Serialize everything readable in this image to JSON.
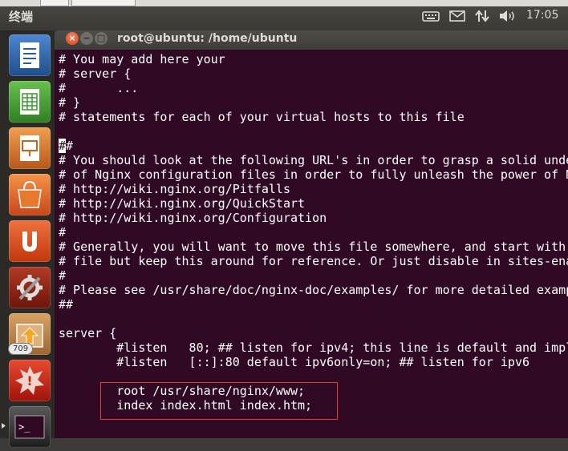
{
  "panel": {
    "app_title": "终端",
    "clock": "17:05",
    "indicators": [
      "keyboard-icon",
      "mail-icon",
      "network-arrows-icon",
      "volume-icon"
    ]
  },
  "launcher": {
    "items": [
      {
        "name": "writer-icon",
        "color": "#2a5b9e"
      },
      {
        "name": "calc-icon",
        "color": "#3a9a2e"
      },
      {
        "name": "impress-icon",
        "color": "#c8641e"
      },
      {
        "name": "software-center-icon",
        "color": "#d95f1c"
      },
      {
        "name": "ubuntu-one-icon",
        "color": "#dd4814"
      },
      {
        "name": "system-settings-icon",
        "color": "#8b1d10"
      },
      {
        "name": "update-manager-icon",
        "color": "#b57a3a"
      },
      {
        "name": "crash-report-icon",
        "color": "#c7200d"
      },
      {
        "name": "terminal-icon",
        "color": "#3a3a3a"
      }
    ],
    "badge": "709"
  },
  "window": {
    "title": "root@ubuntu: /home/ubuntu",
    "close_glyph": "×",
    "min_glyph": "−",
    "max_glyph": "□"
  },
  "terminal": {
    "lines": [
      "# You may add here your",
      "# server {",
      "#       ...",
      "# }",
      "# statements for each of your virtual hosts to this file",
      "",
      "##",
      "# You should look at the following URL's in order to grasp a solid unde",
      "# of Nginx configuration files in order to fully unleash the power of N",
      "# http://wiki.nginx.org/Pitfalls",
      "# http://wiki.nginx.org/QuickStart",
      "# http://wiki.nginx.org/Configuration",
      "#",
      "# Generally, you will want to move this file somewhere, and start with",
      "# file but keep this around for reference. Or just disable in sites-ena",
      "#",
      "# Please see /usr/share/doc/nginx-doc/examples/ for more detailed examp",
      "##",
      "",
      "server {",
      "        #listen   80; ## listen for ipv4; this line is default and impl",
      "        #listen   [::]:80 default ipv6only=on; ## listen for ipv6",
      "",
      "        root /usr/share/nginx/www;",
      "        index index.html index.htm;"
    ]
  }
}
